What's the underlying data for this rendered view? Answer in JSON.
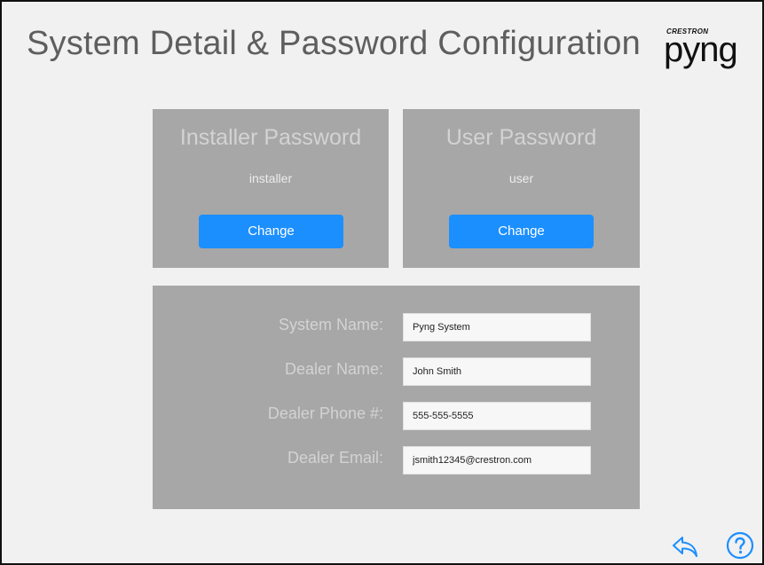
{
  "header": {
    "title": "System Detail & Password Configuration"
  },
  "logo": {
    "brand": "CRESTRON",
    "word": "pyng"
  },
  "installer_password": {
    "heading": "Installer Password",
    "value": "installer",
    "button_label": "Change"
  },
  "user_password": {
    "heading": "User Password",
    "value": "user",
    "button_label": "Change"
  },
  "details": {
    "fields": [
      {
        "label": "System Name:",
        "value": "Pyng System"
      },
      {
        "label": "Dealer Name:",
        "value": "John Smith"
      },
      {
        "label": "Dealer Phone #:",
        "value": "555-555-5555"
      },
      {
        "label": "Dealer Email:",
        "value": "jsmith12345@crestron.com"
      }
    ]
  },
  "footer": {
    "back_icon": "back-arrow-icon",
    "help_icon": "help-icon"
  },
  "colors": {
    "background": "#f1f1f1",
    "panel": "#a7a7a7",
    "accent_button": "#1c8fff",
    "footer_icon": "#1c8fff",
    "title_text": "#5e5e5e"
  }
}
